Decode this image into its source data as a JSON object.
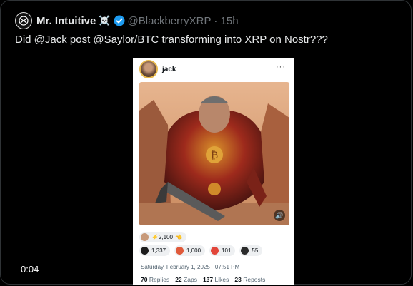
{
  "tweet": {
    "display_name": "Mr. Intuitive",
    "emoji": "☠️",
    "handle_time": "@BlackberryXRP · 15h",
    "text": "Did @Jack post @Saylor/BTC transforming into XRP on Nostr???",
    "video_time": "0:04",
    "accent": "#1d9bf0"
  },
  "embed": {
    "author": "jack",
    "reactions_row1": [
      {
        "count": "2,100",
        "icon": "lightning-icon"
      }
    ],
    "reactions_row2": [
      {
        "count": "1,337",
        "icon": "dark-orb-icon"
      },
      {
        "count": "1,000",
        "icon": "fire-icon"
      },
      {
        "count": "101",
        "icon": "gift-icon"
      },
      {
        "count": "55",
        "icon": "moon-icon"
      }
    ],
    "timestamp": "Saturday, February 1, 2025 · 07:51 PM",
    "stats": {
      "replies_count": "70",
      "replies_label": "Replies",
      "zaps_count": "22",
      "zaps_label": "Zaps",
      "likes_count": "137",
      "likes_label": "Likes",
      "reposts_count": "23",
      "reposts_label": "Reposts"
    }
  }
}
